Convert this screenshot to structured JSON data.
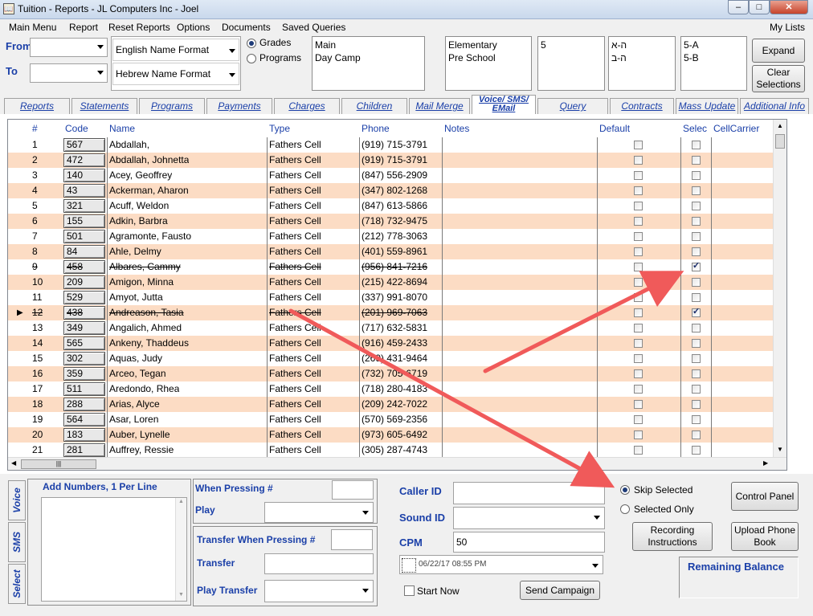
{
  "window": {
    "title": "Tuition - Reports - JL Computers Inc - Joel",
    "min_label": "–",
    "max_label": "□",
    "close_label": "✕"
  },
  "menu": {
    "items": [
      "Main Menu",
      "Report",
      "Reset Reports",
      "Options",
      "Documents",
      "Saved Queries"
    ],
    "right": "My Lists"
  },
  "filters": {
    "from_label": "From",
    "to_label": "To",
    "english_format": "English Name Format",
    "hebrew_format": "Hebrew Name Format",
    "grades_label": "Grades",
    "programs_label": "Programs",
    "list1": [
      "Main",
      "Day Camp"
    ],
    "list2": [
      "Elementary",
      "Pre School"
    ],
    "list3": [
      "5"
    ],
    "list4": [
      "ה-א",
      "ה-ב"
    ],
    "list5": [
      "5-A",
      "5-B"
    ],
    "expand_label": "Expand",
    "clear_label_1": "Clear",
    "clear_label_2": "Selections"
  },
  "tabs": [
    "Reports",
    "Statements",
    "Programs",
    "Payments",
    "Charges",
    "Children",
    "Mail Merge",
    "Voice/ SMS/ EMail",
    "Query",
    "Contracts",
    "Mass Update",
    "Additional Info"
  ],
  "grid": {
    "headers": {
      "num": "#",
      "code": "Code",
      "name": "Name",
      "type": "Type",
      "phone": "Phone",
      "notes": "Notes",
      "default": "Default",
      "select": "Selec",
      "carrier": "CellCarrier"
    },
    "rows": [
      {
        "n": "1",
        "code": "567",
        "name": "Abdallah,",
        "type": "Fathers Cell",
        "phone": "(919) 715-3791",
        "sel": false,
        "strike": false
      },
      {
        "n": "2",
        "code": "472",
        "name": "Abdallah, Johnetta",
        "type": "Fathers Cell",
        "phone": "(919) 715-3791",
        "sel": false,
        "strike": false
      },
      {
        "n": "3",
        "code": "140",
        "name": "Acey, Geoffrey",
        "type": "Fathers Cell",
        "phone": "(847) 556-2909",
        "sel": false,
        "strike": false
      },
      {
        "n": "4",
        "code": "43",
        "name": "Ackerman, Aharon",
        "type": "Fathers Cell",
        "phone": "(347) 802-1268",
        "sel": false,
        "strike": false
      },
      {
        "n": "5",
        "code": "321",
        "name": "Acuff, Weldon",
        "type": "Fathers Cell",
        "phone": "(847) 613-5866",
        "sel": false,
        "strike": false
      },
      {
        "n": "6",
        "code": "155",
        "name": "Adkin, Barbra",
        "type": "Fathers Cell",
        "phone": "(718) 732-9475",
        "sel": false,
        "strike": false
      },
      {
        "n": "7",
        "code": "501",
        "name": "Agramonte, Fausto",
        "type": "Fathers Cell",
        "phone": "(212) 778-3063",
        "sel": false,
        "strike": false
      },
      {
        "n": "8",
        "code": "84",
        "name": "Ahle, Delmy",
        "type": "Fathers Cell",
        "phone": "(401) 559-8961",
        "sel": false,
        "strike": false
      },
      {
        "n": "9",
        "code": "458",
        "name": "Albares, Cammy",
        "type": "Fathers Cell",
        "phone": "(956) 841-7216",
        "sel": true,
        "strike": true
      },
      {
        "n": "10",
        "code": "209",
        "name": "Amigon, Minna",
        "type": "Fathers Cell",
        "phone": "(215) 422-8694",
        "sel": false,
        "strike": false
      },
      {
        "n": "11",
        "code": "529",
        "name": "Amyot, Jutta",
        "type": "Fathers Cell",
        "phone": "(337) 991-8070",
        "sel": false,
        "strike": false
      },
      {
        "n": "12",
        "code": "438",
        "name": "Andreason, Tasia",
        "type": "Fathers Cell",
        "phone": "(201) 969-7063",
        "sel": true,
        "strike": true
      },
      {
        "n": "13",
        "code": "349",
        "name": "Angalich, Ahmed",
        "type": "Fathers Cell",
        "phone": "(717) 632-5831",
        "sel": false,
        "strike": false
      },
      {
        "n": "14",
        "code": "565",
        "name": "Ankeny, Thaddeus",
        "type": "Fathers Cell",
        "phone": "(916) 459-2433",
        "sel": false,
        "strike": false
      },
      {
        "n": "15",
        "code": "302",
        "name": "Aquas, Judy",
        "type": "Fathers Cell",
        "phone": "(269) 431-9464",
        "sel": false,
        "strike": false
      },
      {
        "n": "16",
        "code": "359",
        "name": "Arceo, Tegan",
        "type": "Fathers Cell",
        "phone": "(732) 705-6719",
        "sel": false,
        "strike": false
      },
      {
        "n": "17",
        "code": "511",
        "name": "Aredondo, Rhea",
        "type": "Fathers Cell",
        "phone": "(718) 280-4183",
        "sel": false,
        "strike": false
      },
      {
        "n": "18",
        "code": "288",
        "name": "Arias, Alyce",
        "type": "Fathers Cell",
        "phone": "(209) 242-7022",
        "sel": false,
        "strike": false
      },
      {
        "n": "19",
        "code": "564",
        "name": "Asar, Loren",
        "type": "Fathers Cell",
        "phone": "(570) 569-2356",
        "sel": false,
        "strike": false
      },
      {
        "n": "20",
        "code": "183",
        "name": "Auber, Lynelle",
        "type": "Fathers Cell",
        "phone": "(973) 605-6492",
        "sel": false,
        "strike": false
      },
      {
        "n": "21",
        "code": "281",
        "name": "Auffrey, Ressie",
        "type": "Fathers Cell",
        "phone": "(305) 287-4743",
        "sel": false,
        "strike": false
      }
    ],
    "current_row": 12
  },
  "side_tabs": [
    "Voice",
    "SMS",
    "Select"
  ],
  "voice": {
    "add_numbers": "Add Numbers, 1 Per Line",
    "when_pressing": "When Pressing #",
    "play": "Play",
    "transfer_when": "Transfer When Pressing #",
    "transfer": "Transfer",
    "play_transfer": "Play Transfer",
    "caller_id": "Caller ID",
    "sound_id": "Sound ID",
    "cpm": "CPM",
    "cpm_value": "50",
    "datetime": "06/22/17 08:55 PM",
    "start_now": "Start Now",
    "send_campaign": "Send Campaign",
    "skip_selected": "Skip Selected",
    "selected_only": "Selected Only",
    "recording_1": "Recording",
    "recording_2": "Instructions",
    "control_panel": "Control Panel",
    "upload_1": "Upload Phone",
    "upload_2": "Book",
    "remaining_balance": "Remaining Balance"
  },
  "colors": {
    "accent": "#1a3fa8",
    "row_alt": "#fcdcc4",
    "annotation_arrow": "#f05a5a"
  }
}
